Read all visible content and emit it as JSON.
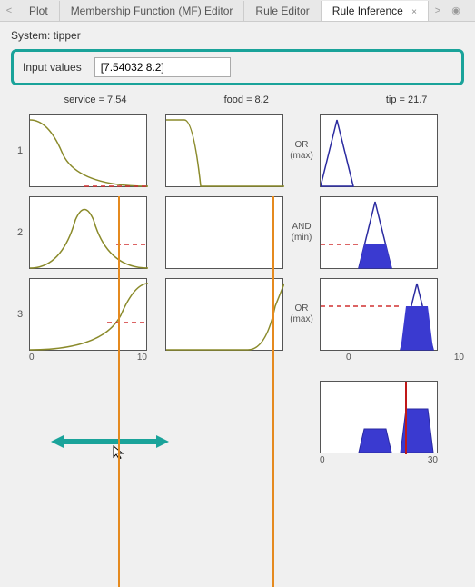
{
  "tabs": {
    "prev_icon": "<",
    "plot": "Plot",
    "mf": "Membership Function (MF) Editor",
    "rule": "Rule Editor",
    "inference": "Rule Inference",
    "close_icon": "×",
    "next_icon": ">",
    "menu_icon": "◉"
  },
  "system_label": "System: tipper",
  "input_label": "Input values",
  "input_value": "[7.54032 8.2]",
  "col_headers": {
    "service": "service = 7.54",
    "food": "food = 8.2",
    "tip": "tip = 21.7"
  },
  "rows": [
    {
      "n": "1",
      "op": "OR",
      "op2": "(max)"
    },
    {
      "n": "2",
      "op": "AND",
      "op2": "(min)"
    },
    {
      "n": "3",
      "op": "OR",
      "op2": "(max)"
    }
  ],
  "axis": {
    "min": "0",
    "max_in": "10",
    "max_out": "30"
  },
  "colors": {
    "curve": "#8a8a2a",
    "mf_line": "#2a2aa0",
    "mf_fill": "#3a3ad0",
    "dash": "#d03030",
    "slider": "#e58a1f",
    "out_line": "#c01818",
    "arrow": "#1aa39a"
  },
  "chart_data": {
    "type": "fuzzy-inference",
    "inputs": [
      {
        "name": "service",
        "range": [
          0,
          10
        ],
        "value": 7.54
      },
      {
        "name": "food",
        "range": [
          0,
          10
        ],
        "value": 8.2
      }
    ],
    "output": {
      "name": "tip",
      "range": [
        0,
        30
      ],
      "value": 21.7
    },
    "rules": [
      {
        "index": 1,
        "operator": "OR-max",
        "antecedents": [
          {
            "input": "service",
            "mf_shape": "zmf-left",
            "params": [
              0,
              4
            ],
            "fire": 0.0
          },
          {
            "input": "food",
            "mf_shape": "zmf-left",
            "params": [
              0,
              3
            ],
            "fire": 0.0
          }
        ],
        "consequent": {
          "mf_shape": "triangle",
          "params": [
            0,
            5,
            10
          ],
          "clip": 0.0
        }
      },
      {
        "index": 2,
        "operator": "AND-min",
        "antecedents": [
          {
            "input": "service",
            "mf_shape": "gaussian",
            "params": [
              5,
              1.7
            ],
            "fire": 0.35
          },
          {
            "input": "food",
            "mf_shape": "none",
            "fire": 1.0
          }
        ],
        "consequent": {
          "mf_shape": "triangle",
          "params": [
            10,
            15,
            20
          ],
          "clip": 0.35
        }
      },
      {
        "index": 3,
        "operator": "OR-max",
        "antecedents": [
          {
            "input": "service",
            "mf_shape": "smf-right",
            "params": [
              6,
              10
            ],
            "fire": 0.65
          },
          {
            "input": "food",
            "mf_shape": "smf-right",
            "params": [
              7,
              10
            ],
            "fire": 0.65
          }
        ],
        "consequent": {
          "mf_shape": "triangle",
          "params": [
            20,
            25,
            30
          ],
          "clip": 0.65
        }
      }
    ],
    "aggregate_output": {
      "centroid": 21.7,
      "shapes": [
        {
          "type": "trapezoid-clip",
          "base": [
            10,
            20
          ],
          "peak": 15,
          "clip": 0.35
        },
        {
          "type": "trapezoid-clip",
          "base": [
            20,
            30
          ],
          "peak": 25,
          "clip": 0.65
        }
      ]
    }
  }
}
